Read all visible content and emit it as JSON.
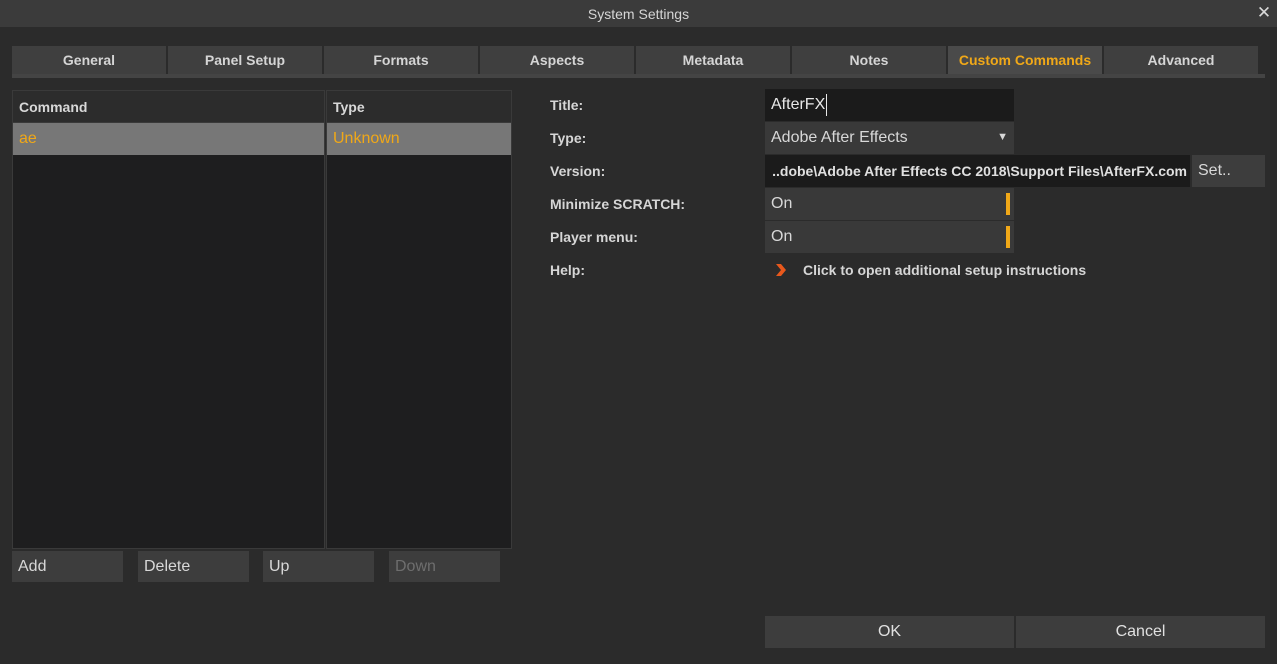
{
  "window": {
    "title": "System Settings",
    "close_glyph": "✕"
  },
  "tabs": [
    {
      "label": "General"
    },
    {
      "label": "Panel Setup"
    },
    {
      "label": "Formats"
    },
    {
      "label": "Aspects"
    },
    {
      "label": "Metadata"
    },
    {
      "label": "Notes"
    },
    {
      "label": "Custom Commands",
      "active": true
    },
    {
      "label": "Advanced"
    }
  ],
  "command_list": {
    "columns": {
      "command": "Command",
      "type": "Type"
    },
    "rows": [
      {
        "command": "ae",
        "type": "Unknown",
        "selected": true
      }
    ]
  },
  "list_buttons": {
    "add": "Add",
    "delete": "Delete",
    "up": "Up",
    "down": "Down"
  },
  "form": {
    "title": {
      "label": "Title:",
      "value": "AfterFX"
    },
    "type": {
      "label": "Type:",
      "value": "Adobe After Effects"
    },
    "version": {
      "label": "Version:",
      "path": "..dobe\\Adobe After Effects CC 2018\\Support Files\\AfterFX.com",
      "set_button": "Set.."
    },
    "minimize": {
      "label": "Minimize SCRATCH:",
      "value": "On"
    },
    "player_menu": {
      "label": "Player menu:",
      "value": "On"
    },
    "help": {
      "label": "Help:",
      "link_text": "Click to open additional setup instructions"
    }
  },
  "dialog_buttons": {
    "ok": "OK",
    "cancel": "Cancel"
  },
  "colors": {
    "accent": "#f0a818",
    "help_chevron": "#e8581c",
    "background": "#2b2b2b"
  },
  "icons": {
    "close": "close-icon",
    "dropdown": "chevron-down-icon",
    "help": "chevron-right-icon"
  }
}
